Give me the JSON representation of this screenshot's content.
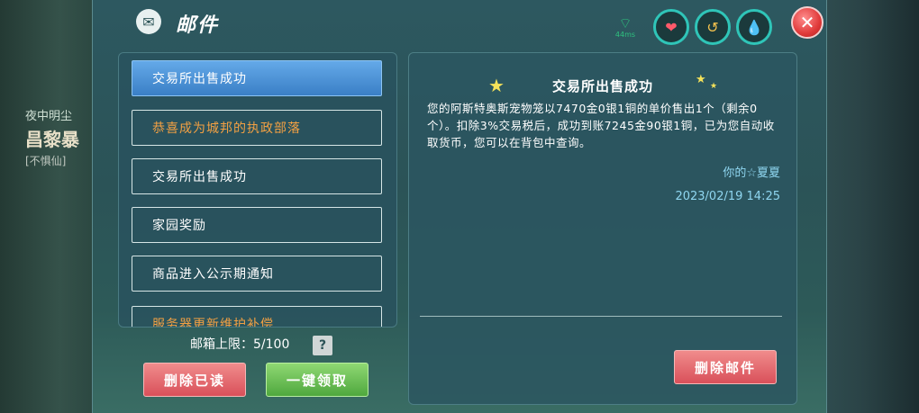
{
  "background": {
    "npc_line1": "夜中明尘",
    "npc_line2": "昌黎暴",
    "npc_line3": "[不惧仙]"
  },
  "title": {
    "icon": "mail-icon",
    "text": "邮件"
  },
  "status": {
    "ping": "44ms",
    "icons": [
      "wifi-icon",
      "heart-icon",
      "stamina-icon",
      "water-drop-icon"
    ]
  },
  "mail_list": {
    "items": [
      {
        "label": "交易所出售成功",
        "state": "selected"
      },
      {
        "label": "恭喜成为城邦的执政部落",
        "state": "unread"
      },
      {
        "label": "交易所出售成功",
        "state": "read"
      },
      {
        "label": "家园奖励",
        "state": "read"
      },
      {
        "label": "商品进入公示期通知",
        "state": "read"
      },
      {
        "label": "服务器更新维护补偿",
        "state": "unread"
      }
    ]
  },
  "inbox_limit": "邮箱上限：5/100",
  "help_label": "?",
  "buttons": {
    "delete_read": "删除已读",
    "claim_all": "一键领取",
    "delete_mail": "删除邮件"
  },
  "detail": {
    "title": "交易所出售成功",
    "body": "您的阿斯特奥斯宠物笼以7470金0银1铜的单价售出1个（剩余0个）。扣除3%交易税后，成功到账7245金90银1铜，已为您自动收取货币，您可以在背包中查询。",
    "sender": "你的☆夏夏",
    "timestamp": "2023/02/19 14:25"
  },
  "colors": {
    "accent_blue": "#3a7fc6",
    "unread_orange": "#f2a043",
    "delete_red": "#d9505a",
    "claim_green": "#4fa83e",
    "link_cyan": "#8fd6f0"
  }
}
